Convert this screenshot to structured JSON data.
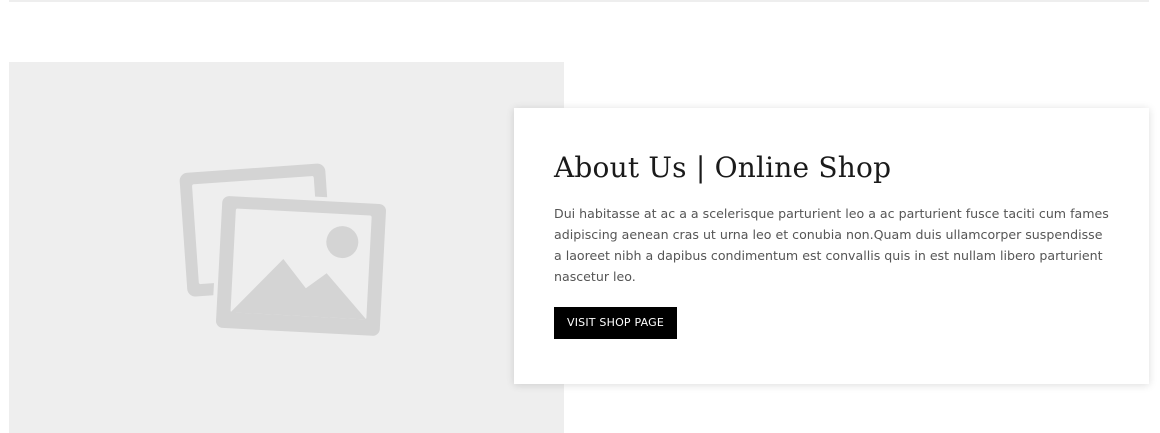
{
  "about": {
    "title": "About Us | Online Shop",
    "text": "Dui habitasse at ac a a scelerisque parturient leo a ac parturient fusce taciti cum fames adipiscing aenean cras ut urna leo et conubia non.Quam duis ullamcorper suspendisse a laoreet nibh a dapibus condimentum est convallis quis in est nullam libero parturient nascetur leo.",
    "button_label": "VISIT SHOP PAGE"
  },
  "image": {
    "icon": "image-placeholder-icon"
  },
  "colors": {
    "panel_bg": "#eeeeee",
    "icon": "#d4d4d4",
    "button_bg": "#000000",
    "button_text": "#ffffff",
    "title": "#1a1a1a",
    "body_text": "#555555"
  }
}
